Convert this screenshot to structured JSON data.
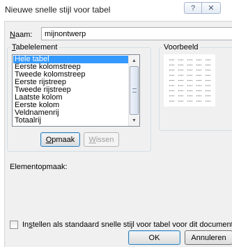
{
  "window": {
    "title": "Nieuwe snelle stijl voor tabel",
    "help_glyph": "?",
    "close_glyph": "✕"
  },
  "name": {
    "label_accel": "N",
    "label_rest": "aam:",
    "value": "mijnontwerp"
  },
  "table_element": {
    "group_label_accel": "T",
    "group_label_rest": "abelelement",
    "items": [
      "Hele tabel",
      "Eerste kolomstreep",
      "Tweede kolomstreep",
      "Eerste rijstreep",
      "Tweede rijstreep",
      "Laatste kolom",
      "Eerste kolom",
      "Veldnamenrij",
      "Totaalrij"
    ],
    "selected_index": 0,
    "format_button_accel": "O",
    "format_button_rest": "pmaak",
    "clear_button_accel": "W",
    "clear_button_rest": "issen"
  },
  "preview": {
    "label": "Voorbeeld"
  },
  "element_format": {
    "label": "Elementopmaak:"
  },
  "default_checkbox": {
    "label_pre": "In",
    "label_accel": "s",
    "label_post": "tellen als standaard snelle stijl voor tabel voor dit document",
    "checked": false
  },
  "footer": {
    "ok_label": "OK",
    "cancel_label": "Annuleren"
  },
  "colors": {
    "selection": "#3399ff",
    "dialog_bg": "#f0f0f0"
  }
}
